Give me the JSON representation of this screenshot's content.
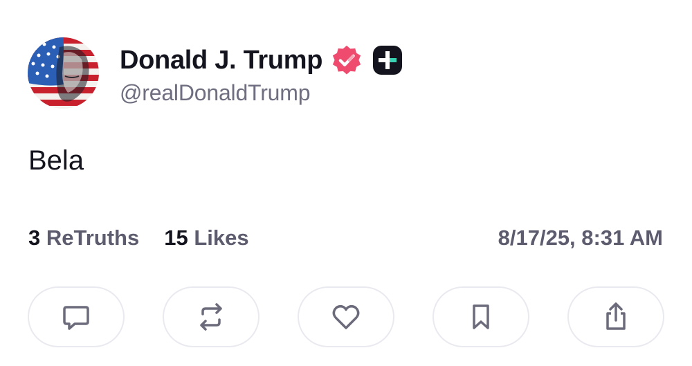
{
  "author": {
    "display_name": "Donald J. Trump",
    "handle": "@realDonaldTrump",
    "verified_icon": "verified-badge-icon",
    "plus_icon": "truth-plus-badge-icon"
  },
  "post": {
    "text": "Bela"
  },
  "stats": {
    "retruths_count": "3",
    "retruths_label": "ReTruths",
    "likes_count": "15",
    "likes_label": "Likes",
    "timestamp": "8/17/25, 8:31 AM"
  },
  "actions": [
    {
      "icon": "comment-icon"
    },
    {
      "icon": "retruth-icon"
    },
    {
      "icon": "heart-icon"
    },
    {
      "icon": "bookmark-icon"
    },
    {
      "icon": "share-icon"
    }
  ],
  "colors": {
    "verified": "#ef4b6e",
    "icon": "#6b6b7b",
    "text_primary": "#14141f",
    "text_secondary": "#6e6e80",
    "button_border": "#e9e9f0"
  }
}
